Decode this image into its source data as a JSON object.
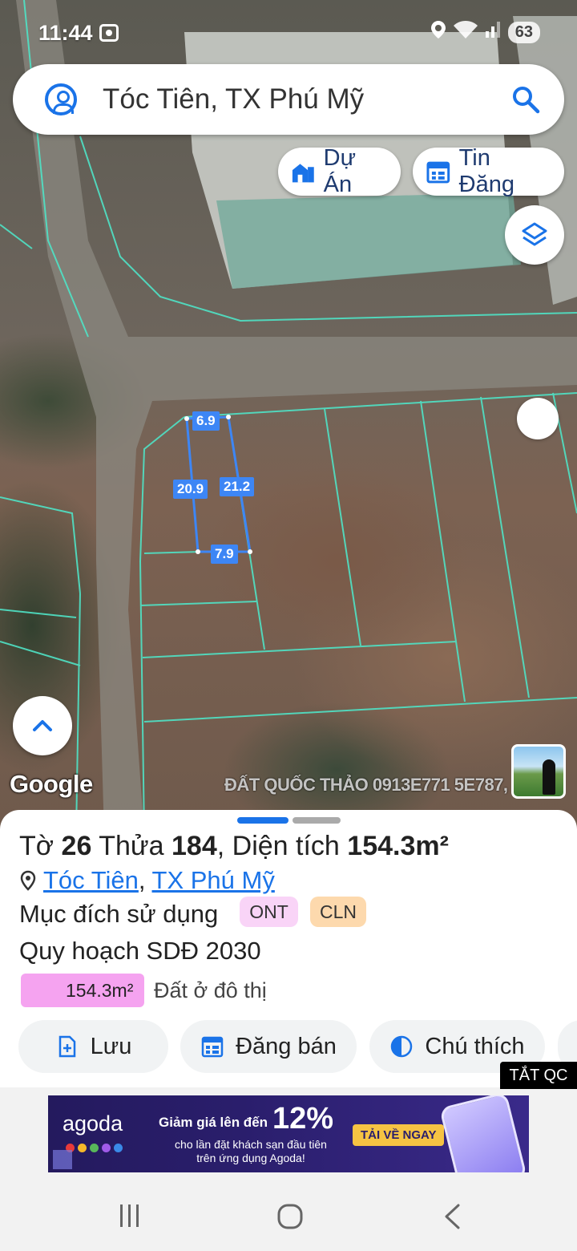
{
  "status_bar": {
    "time": "11:44",
    "battery": "63"
  },
  "search": {
    "query": "Tóc Tiên, TX Phú Mỹ"
  },
  "chips": {
    "projects": "Dự Án",
    "listings": "Tin Đăng"
  },
  "map": {
    "dimensions": {
      "top": "6.9",
      "left": "20.9",
      "right": "21.2",
      "bottom": "7.9"
    },
    "google_logo": "Google",
    "watermark": "ĐẤT QUỐC THẢO 0913E771 5E787,"
  },
  "parcel": {
    "title_prefix": "Tờ",
    "sheet_no": "26",
    "parcel_word": "Thửa",
    "parcel_no": "184",
    "area_word": ", Diện tích",
    "area": "154.3m²",
    "location_commune": "Tóc Tiên",
    "location_separator": ",",
    "location_town": "TX Phú Mỹ",
    "purpose_label": "Mục đích sử dụng",
    "tags": [
      {
        "code": "ONT",
        "color": "#f9d4f7"
      },
      {
        "code": "CLN",
        "color": "#fdd9ad"
      }
    ],
    "plan_label": "Quy hoạch SDĐ 2030",
    "plan_value": "154.3m²",
    "plan_type": "Đất ở đô thị",
    "plan_color": "#f5a3f0"
  },
  "actions": {
    "save": "Lưu",
    "post_sale": "Đăng bán",
    "legend": "Chú thích"
  },
  "ad": {
    "close_label": "TẮT QC",
    "brand": "agoda",
    "headline": "Giảm giá lên đến",
    "percent": "12%",
    "sub1": "cho lần đặt khách sạn đầu tiên",
    "sub2": "trên ứng dụng Agoda!",
    "cta": "TẢI VỀ NGAY"
  },
  "accent_color": "#1a73e8"
}
